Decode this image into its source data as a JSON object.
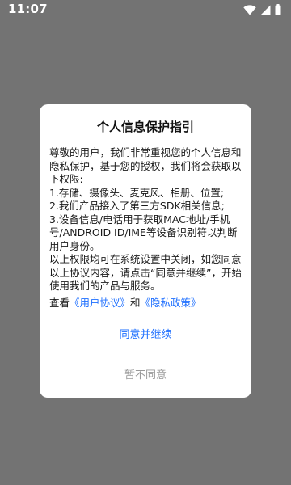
{
  "status_bar": {
    "time": "11:07",
    "icons": [
      "wifi-icon",
      "signal-icon",
      "battery-icon"
    ]
  },
  "dialog": {
    "title": "个人信息保护指引",
    "paragraphs": [
      "尊敬的用户，我们非常重视您的个人信息和隐私保护，基于您的授权，我们将会获取以下权限:",
      "1.存储、摄像头、麦克风、相册、位置;",
      "2.我们产品接入了第三方SDK相关信息;",
      "3.设备信息/电话用于获取MAC地址/手机号/ANDROID ID/IME等设备识别符以判断用户身份。",
      "以上权限均可在系统设置中关闭，如您同意以上协议内容，请点击“同意并继续”，开始使用我们的产品与服务。"
    ],
    "view_prefix": "查看",
    "user_agreement_link": "《用户协议》",
    "and_text": "和",
    "privacy_policy_link": "《隐私政策》",
    "agree_button": "同意并继续",
    "disagree_button": "暂不同意"
  },
  "colors": {
    "overlay": "#737373",
    "link": "#1e6fff",
    "disagree": "#999999"
  }
}
